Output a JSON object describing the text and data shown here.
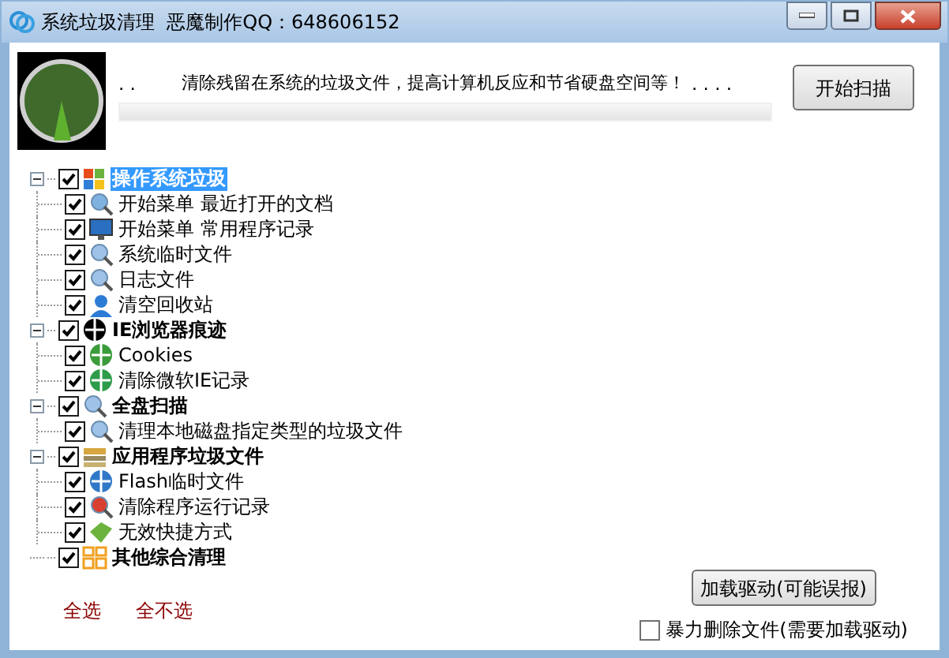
{
  "window": {
    "title": "系统垃圾清理  恶魔制作QQ：648606152"
  },
  "header": {
    "dots_left": ". .",
    "message": "清除残留在系统的垃圾文件，提高计算机反应和节省硬盘空间等！",
    "dots_right": ". . . .",
    "progress": {
      "level": 0
    },
    "scan_button": "开始扫描"
  },
  "tree": [
    {
      "label": "操作系统垃圾",
      "checked": true,
      "expanded": true,
      "selected": true,
      "children": [
        {
          "label": "开始菜单 最近打开的文档",
          "checked": true,
          "selected": false
        },
        {
          "label": "开始菜单 常用程序记录",
          "checked": true,
          "selected": false
        },
        {
          "label": "系统临时文件",
          "checked": true,
          "selected": false
        },
        {
          "label": "日志文件",
          "checked": true,
          "selected": false
        },
        {
          "label": "清空回收站",
          "checked": true,
          "selected": false
        }
      ]
    },
    {
      "label": "IE浏览器痕迹",
      "checked": true,
      "expanded": true,
      "selected": false,
      "children": [
        {
          "label": "Cookies",
          "checked": true,
          "selected": false
        },
        {
          "label": "清除微软IE记录",
          "checked": true,
          "selected": false
        }
      ]
    },
    {
      "label": "全盘扫描",
      "checked": true,
      "expanded": true,
      "selected": false,
      "children": [
        {
          "label": "清理本地磁盘指定类型的垃圾文件",
          "checked": true,
          "selected": false
        }
      ]
    },
    {
      "label": "应用程序垃圾文件",
      "checked": true,
      "expanded": true,
      "selected": false,
      "children": [
        {
          "label": "Flash临时文件",
          "checked": true,
          "selected": false
        },
        {
          "label": "清除程序运行记录",
          "checked": true,
          "selected": false
        },
        {
          "label": "无效快捷方式",
          "checked": true,
          "selected": false
        }
      ]
    },
    {
      "label": "其他综合清理",
      "checked": true,
      "selected": false
    }
  ],
  "select_all": "全选",
  "select_none": "全不选",
  "driver_button": "加载驱动(可能误报)",
  "force_delete": {
    "label": "暴力删除文件(需要加载驱动)",
    "checked": false
  }
}
